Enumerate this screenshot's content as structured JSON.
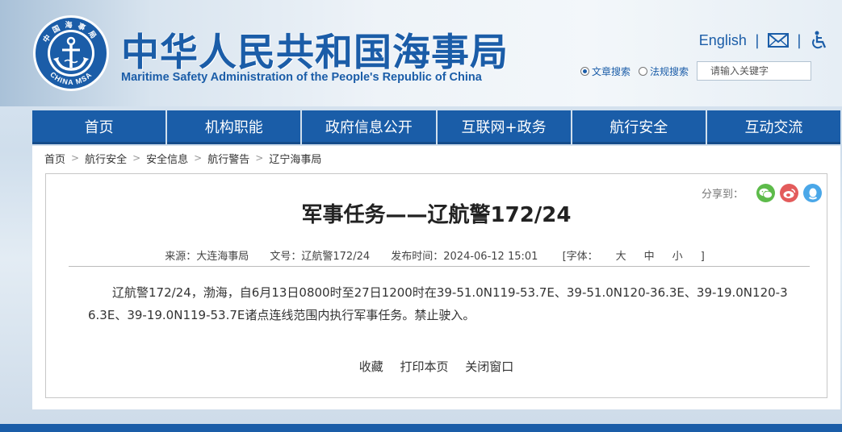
{
  "header": {
    "title_cn": "中华人民共和国海事局",
    "title_en": "Maritime Safety Administration of the People's Republic of China",
    "logo_top_text": "中国海事局",
    "logo_bottom_text": "CHINA MSA",
    "english_link": "English",
    "separator": "|",
    "mail_icon": "envelope-icon",
    "accessibility_icon": "wheelchair-icon",
    "search": {
      "option_article": "文章搜索",
      "option_law": "法规搜索",
      "placeholder": "请输入关键字"
    },
    "brand_color": "#1b5da8"
  },
  "nav": {
    "items": [
      "首页",
      "机构职能",
      "政府信息公开",
      "互联网+政务",
      "航行安全",
      "互动交流"
    ],
    "color": "#1a5da8"
  },
  "breadcrumb": {
    "items": [
      "首页",
      "航行安全",
      "安全信息",
      "航行警告",
      "辽宁海事局"
    ],
    "separator": ">"
  },
  "article": {
    "share_label": "分享到：",
    "share_icons": [
      "wechat-icon",
      "weibo-icon",
      "qq-icon"
    ],
    "title": "军事任务——辽航警172/24",
    "meta": {
      "source": "来源：大连海事局",
      "doc_no": "文号：辽航警172/24",
      "published": "发布时间：2024-06-12 15:01",
      "font_label_open": "[字体：",
      "font_large": "大",
      "font_medium": "中",
      "font_small": "小",
      "font_label_close": "]"
    },
    "body": "辽航警172/24，渤海，自6月13日0800时至27日1200时在39-51.0N119-53.7E、39-51.0N120-36.3E、39-19.0N120-36.3E、39-19.0N119-53.7E诸点连线范围内执行军事任务。禁止驶入。",
    "actions": [
      "收藏",
      "打印本页",
      "关闭窗口"
    ]
  }
}
